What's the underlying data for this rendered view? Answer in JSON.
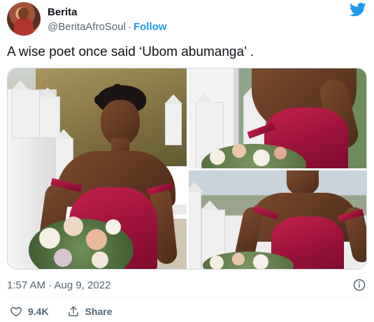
{
  "author": {
    "display_name": "Berita",
    "handle": "@BeritaAfroSoul",
    "separator": "·",
    "follow_label": "Follow"
  },
  "tweet": {
    "text": "A wise poet once said ‘Ubom abumanga’ ."
  },
  "media": {
    "photo_count": 3
  },
  "meta": {
    "timestamp": "1:57 AM · Aug 9, 2022"
  },
  "actions": {
    "like_count": "9.4K",
    "share_label": "Share"
  },
  "icons": {
    "brand": "twitter-bird-icon",
    "info": "info-icon",
    "like": "heart-icon",
    "share": "share-icon"
  },
  "colors": {
    "brand_blue": "#1d9bf0",
    "text_primary": "#0f1419",
    "text_secondary": "#536471",
    "border": "#cfd9de"
  }
}
